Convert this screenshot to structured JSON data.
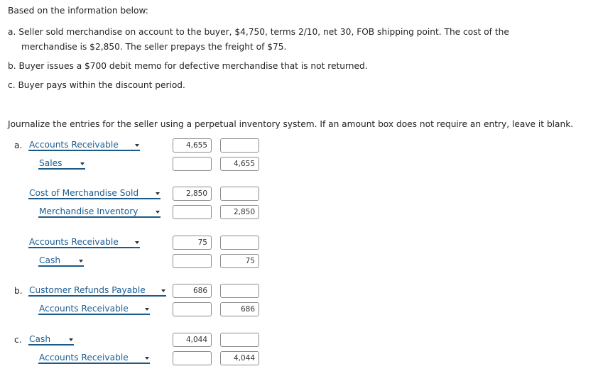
{
  "intro": "Based on the information below:",
  "items": {
    "a_line1": "a. Seller sold merchandise on account to the buyer, $4,750, terms 2/10, net 30, FOB shipping point. The cost of the",
    "a_line2": "merchandise is $2,850. The seller prepays the freight of $75.",
    "b": "b. Buyer issues a $700 debit memo for defective merchandise that is not returned.",
    "c": "c. Buyer pays within the discount period."
  },
  "instructions": "Journalize the entries for the seller using a perpetual inventory system. If an amount box does not require an entry, leave it blank.",
  "entries": [
    {
      "letter": "a.",
      "account": "Accounts Receivable",
      "debit": "4,655",
      "credit": ""
    },
    {
      "letter": "",
      "account": "Sales",
      "debit": "",
      "credit": "4,655"
    },
    {
      "letter": "",
      "account": "Cost of Merchandise Sold",
      "debit": "2,850",
      "credit": ""
    },
    {
      "letter": "",
      "account": "Merchandise Inventory",
      "debit": "",
      "credit": "2,850"
    },
    {
      "letter": "",
      "account": "Accounts Receivable",
      "debit": "75",
      "credit": ""
    },
    {
      "letter": "",
      "account": "Cash",
      "debit": "",
      "credit": "75"
    },
    {
      "letter": "b.",
      "account": "Customer Refunds Payable",
      "debit": "686",
      "credit": ""
    },
    {
      "letter": "",
      "account": "Accounts Receivable",
      "debit": "",
      "credit": "686"
    },
    {
      "letter": "c.",
      "account": "Cash",
      "debit": "4,044",
      "credit": ""
    },
    {
      "letter": "",
      "account": "Accounts Receivable",
      "debit": "",
      "credit": "4,044"
    }
  ]
}
